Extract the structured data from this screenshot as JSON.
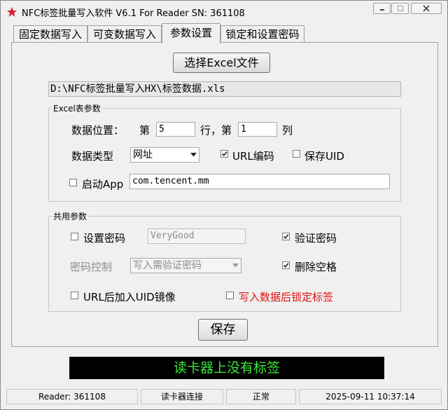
{
  "window": {
    "title": "NFC标签批量写入软件 V6.1 For Reader  SN:  361108"
  },
  "tabs": [
    {
      "label": "固定数据写入"
    },
    {
      "label": "可变数据写入"
    },
    {
      "label": "参数设置"
    },
    {
      "label": "锁定和设置密码"
    }
  ],
  "active_tab": "参数设置",
  "file": {
    "select_button": "选择Excel文件",
    "path": "D:\\NFC标签批量写入HX\\标签数据.xls"
  },
  "excel": {
    "group_title": "Excel表参数",
    "position_label": "数据位置：",
    "row_prefix": "第",
    "row_value": "5",
    "row_suffix": "行，第",
    "col_value": "1",
    "col_suffix": "列",
    "type_label": "数据类型",
    "type_value": "网址",
    "url_encode_label": "URL编码",
    "url_encode_checked": true,
    "save_uid_label": "保存UID",
    "save_uid_checked": false,
    "launch_app_label": "启动App",
    "launch_app_checked": false,
    "app_package": "com.tencent.mm"
  },
  "common": {
    "group_title": "共用参数",
    "set_password_label": "设置密码",
    "set_password_checked": false,
    "password_value": "VeryGood",
    "verify_password_label": "验证密码",
    "verify_password_checked": true,
    "password_control_label": "密码控制",
    "password_control_value": "写入需验证密码",
    "remove_spaces_label": "删除空格",
    "remove_spaces_checked": true,
    "uid_mirror_label": "URL后加入UID镜像",
    "uid_mirror_checked": false,
    "lock_after_write_label": "写入数据后锁定标签",
    "lock_after_write_checked": false
  },
  "save_button": "保存",
  "status_message": "读卡器上没有标签",
  "statusbar": {
    "reader": "Reader: 361108",
    "connection": "读卡器连接",
    "state": "正常",
    "datetime": "2025-09-11 10:37:14"
  },
  "colors": {
    "status_bg": "#000000",
    "status_text": "#3ce83c",
    "warning_text": "#e01010"
  }
}
